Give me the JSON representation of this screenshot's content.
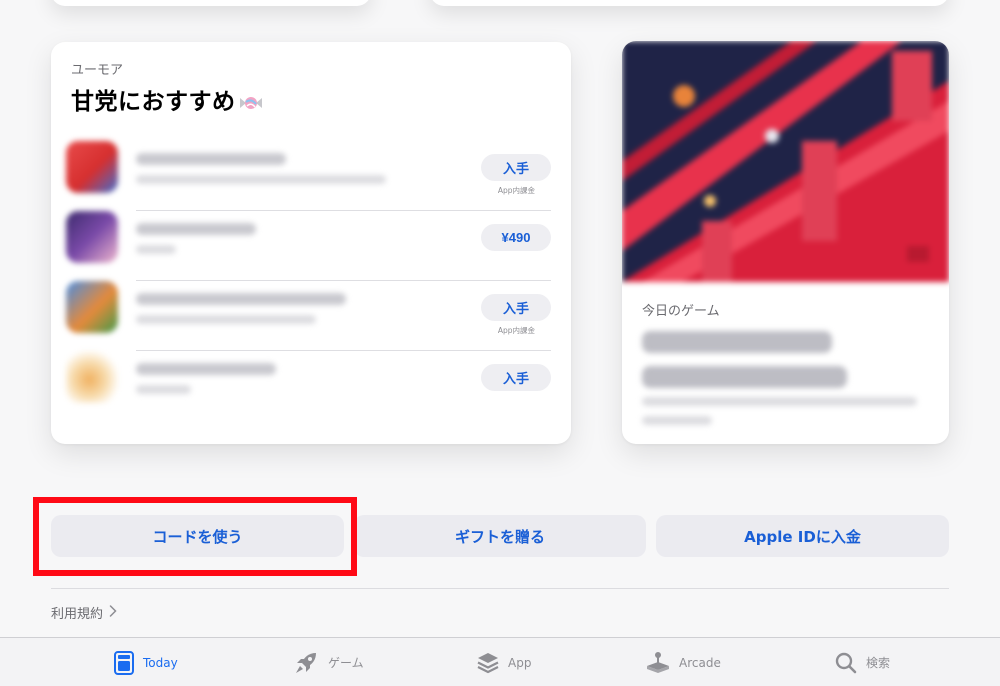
{
  "humor_card": {
    "eyebrow": "ユーモア",
    "title": "甘党におすすめ",
    "apps": [
      {
        "button": "入手",
        "note": "App内課金",
        "icon_colors": [
          "#e53b3b",
          "#3a6fd0"
        ]
      },
      {
        "button": "¥490",
        "note": "",
        "icon_colors": [
          "#5b3c8c",
          "#e8a7c4"
        ]
      },
      {
        "button": "入手",
        "note": "App内課金",
        "icon_colors": [
          "#4b8de0",
          "#e58a3b"
        ]
      },
      {
        "button": "入手",
        "note": "",
        "icon_colors": [
          "#f4c27a",
          "#ffffff"
        ]
      }
    ]
  },
  "game_card": {
    "label": "今日のゲーム"
  },
  "actions": {
    "redeem": "コードを使う",
    "gift": "ギフトを贈る",
    "add_funds": "Apple IDに入金"
  },
  "terms": {
    "label": "利用規約",
    "chevron": "chevron-right-icon"
  },
  "tabbar": {
    "tabs": [
      {
        "label": "Today",
        "icon": "today-icon",
        "active": true
      },
      {
        "label": "ゲーム",
        "icon": "rocket-icon",
        "active": false
      },
      {
        "label": "App",
        "icon": "app-stack-icon",
        "active": false
      },
      {
        "label": "Arcade",
        "icon": "arcade-icon",
        "active": false
      },
      {
        "label": "検索",
        "icon": "search-icon",
        "active": false
      }
    ]
  },
  "colors": {
    "accent": "#1a6cf0",
    "button_text": "#1a5fd6",
    "highlight": "#ff0a16"
  }
}
